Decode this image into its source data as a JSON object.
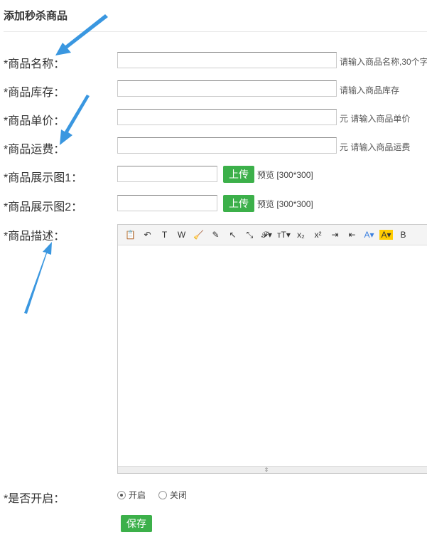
{
  "title": "添加秒杀商品",
  "fields": {
    "name": {
      "label": "*商品名称：",
      "hint": "请输入商品名称,30个字"
    },
    "stock": {
      "label": "*商品库存：",
      "hint": "请输入商品库存"
    },
    "price": {
      "label": "*商品单价：",
      "hint": "元 请输入商品单价"
    },
    "shipping": {
      "label": "*商品运费：",
      "hint": "元 请输入商品运费"
    },
    "image1": {
      "label": "*商品展示图1：",
      "upload": "上传",
      "preview": "预览 [300*300]"
    },
    "image2": {
      "label": "*商品展示图2：",
      "upload": "上传",
      "preview": "预览 [300*300]"
    },
    "description": {
      "label": "*商品描述："
    },
    "enabled": {
      "label": "*是否开启：",
      "options": [
        "开启",
        "关闭"
      ],
      "selected": "开启"
    }
  },
  "toolbar": [
    "📋",
    "↶",
    "T",
    "W",
    "🧹",
    "✎",
    "↖",
    "⤡",
    "𝓕▾",
    "тT▾",
    "x₂",
    "x²",
    "⇥",
    "⇤",
    "A▾",
    "A▾",
    "B"
  ],
  "save": "保存",
  "colors": {
    "accent": "#3cb04a",
    "arrow": "#3a97e0"
  }
}
